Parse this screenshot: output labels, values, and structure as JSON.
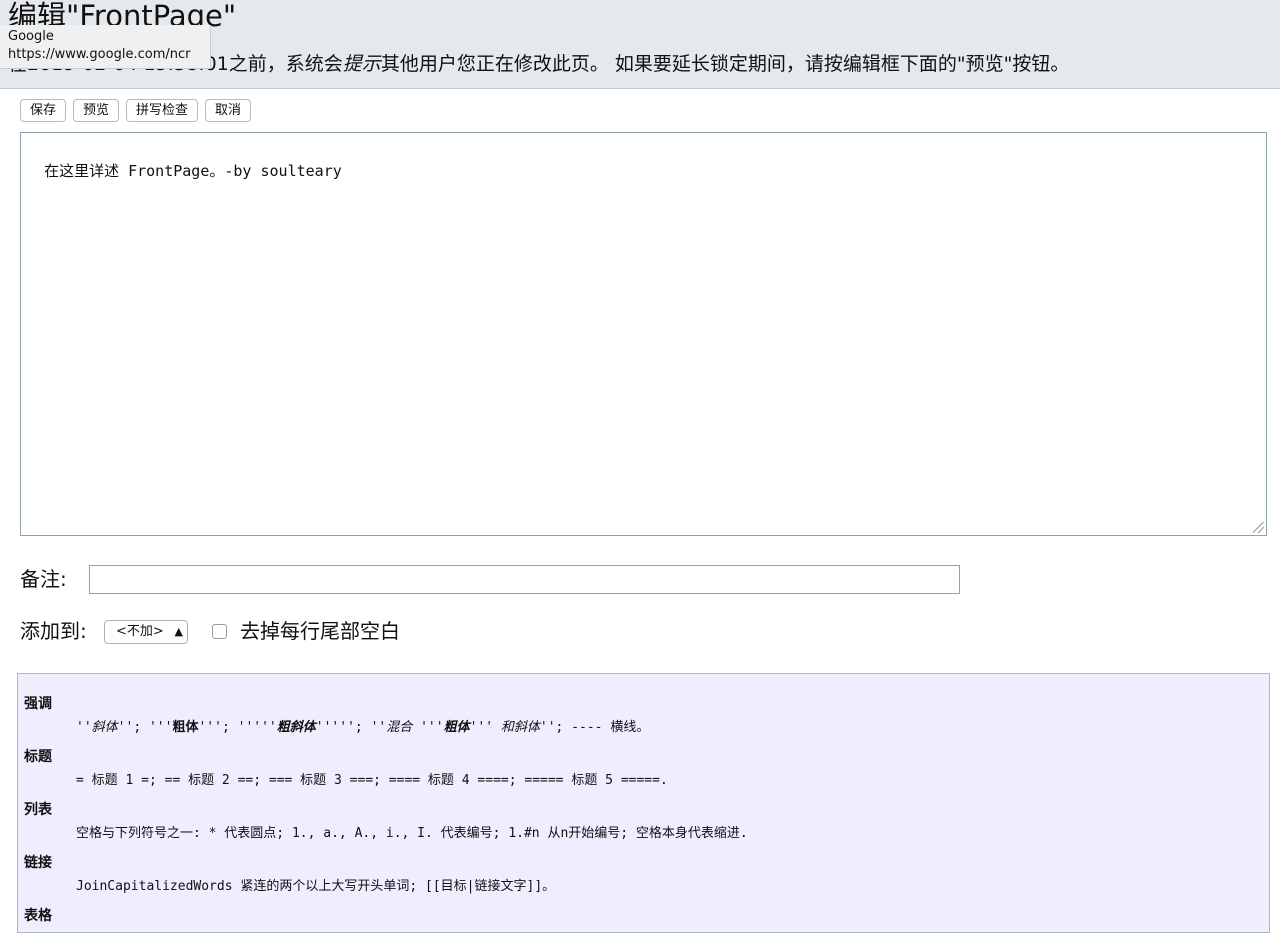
{
  "header": {
    "title": "编辑\"FrontPage\"",
    "lock_notice": {
      "prefix": "在2019-02-04 15:38:01之前，系统会",
      "emphasis": "提示",
      "suffix": "其他用户您正在修改此页。 如果要延长锁定期间，请按编辑框下面的\"预览\"按钮。"
    },
    "tooltip": {
      "title": "Google",
      "url": "https://www.google.com/ncr"
    }
  },
  "toolbar": {
    "save_label": "保存",
    "preview_label": "预览",
    "spellcheck_label": "拼写检查",
    "cancel_label": "取消"
  },
  "editor": {
    "content": "在这里详述 FrontPage。-by soulteary"
  },
  "comment": {
    "label": "备注:",
    "value": ""
  },
  "add_to": {
    "label": "添加到:",
    "selected": "<不加>",
    "trim_label": "去掉每行尾部空白"
  },
  "help": {
    "emphasis": {
      "term": "强调",
      "italic": "斜体",
      "bold": "粗体",
      "bold_italic": "粗斜体",
      "mixed": "混合",
      "mixed_and": " 和斜体",
      "hr": "横线。"
    },
    "headings": {
      "term": "标题",
      "text": "= 标题 1 =; == 标题 2 ==; === 标题 3 ===; ==== 标题 4 ====; ===== 标题 5 =====."
    },
    "lists": {
      "term": "列表",
      "text": "空格与下列符号之一: * 代表圆点; 1., a., A., i., I. 代表编号; 1.#n 从n开始编号; 空格本身代表缩进."
    },
    "links": {
      "term": "链接",
      "text": "JoinCapitalizedWords 紧连的两个以上大写开头单词; [[目标|链接文字]]。"
    },
    "tables": {
      "term": "表格"
    }
  }
}
